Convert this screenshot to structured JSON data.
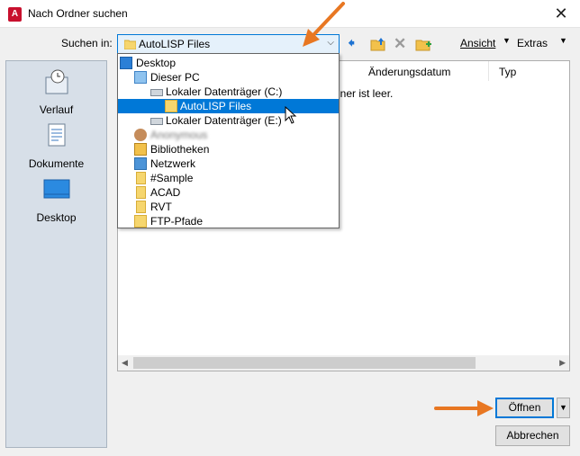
{
  "window": {
    "title": "Nach Ordner suchen",
    "close_glyph": "✕"
  },
  "lookin": {
    "label": "Suchen in:",
    "value": "AutoLISP Files"
  },
  "toolbar": {
    "view_label": "Ansicht",
    "extras_label": "Extras",
    "icons": [
      "back-arrow-icon",
      "up-folder-icon",
      "delete-icon",
      "new-folder-icon"
    ]
  },
  "places": [
    {
      "label": "Verlauf",
      "icon": "history-icon"
    },
    {
      "label": "Dokumente",
      "icon": "documents-icon"
    },
    {
      "label": "Desktop",
      "icon": "desktop-icon"
    }
  ],
  "list": {
    "columns": [
      "Änderungsdatum",
      "Typ"
    ],
    "empty_message": "dner ist leer."
  },
  "dropdown_items": [
    {
      "label": "Desktop",
      "icon": "desktop-icon"
    },
    {
      "label": "Dieser PC",
      "icon": "pc-icon"
    },
    {
      "label": "Lokaler Datenträger (C:)",
      "icon": "drive-icon"
    },
    {
      "label": "AutoLISP Files",
      "icon": "folder-icon",
      "selected": true
    },
    {
      "label": "Lokaler Datenträger (E:)",
      "icon": "drive-icon"
    },
    {
      "label": "Anonymous",
      "icon": "user-icon",
      "blurred": true
    },
    {
      "label": "Bibliotheken",
      "icon": "library-icon"
    },
    {
      "label": "Netzwerk",
      "icon": "network-icon"
    },
    {
      "label": "#Sample",
      "icon": "folder-icon"
    },
    {
      "label": "ACAD",
      "icon": "folder-icon"
    },
    {
      "label": "RVT",
      "icon": "folder-icon"
    },
    {
      "label": "FTP-Pfade",
      "icon": "ftp-folder-icon"
    }
  ],
  "buttons": {
    "open": "Öffnen",
    "cancel": "Abbrechen"
  },
  "colors": {
    "accent": "#0078d7",
    "annotation_arrow": "#e87722",
    "places_bg": "#d7dfe8"
  }
}
